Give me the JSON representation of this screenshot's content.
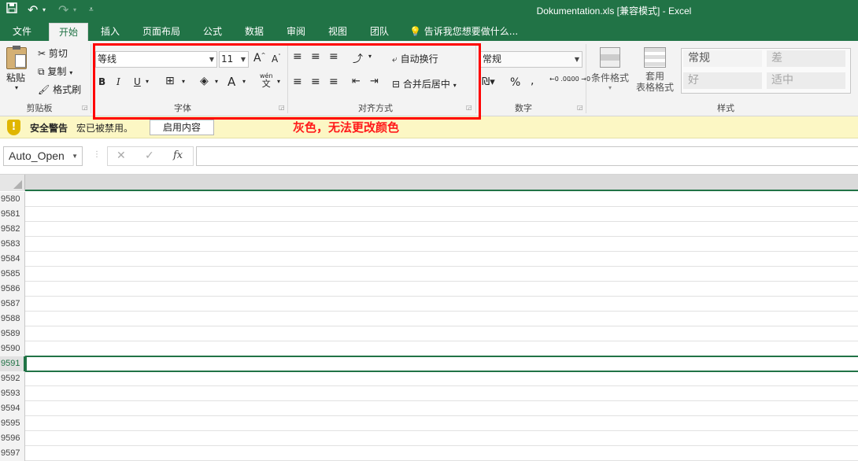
{
  "titlebar": {
    "title": "Dokumentation.xls  [兼容模式]  -  Excel",
    "save_icon": "save-icon",
    "undo_icon": "undo-icon",
    "redo_icon": "redo-icon",
    "customize_icon": "customize-qat-icon"
  },
  "tabs": [
    "文件",
    "开始",
    "插入",
    "页面布局",
    "公式",
    "数据",
    "审阅",
    "视图",
    "团队"
  ],
  "active_tab": "开始",
  "tell_me": "告诉我您想要做什么...",
  "ribbon": {
    "clipboard": {
      "paste": "粘贴",
      "cut": "剪切",
      "copy": "复制",
      "format_painter": "格式刷",
      "label": "剪贴板"
    },
    "font": {
      "font_name": "等线",
      "font_size": "11",
      "grow": "A",
      "shrink": "A",
      "bold": "B",
      "italic": "I",
      "underline": "U",
      "font_color": "A",
      "phonetic": "wén",
      "phonetic_sub": "文",
      "label": "字体"
    },
    "alignment": {
      "wrap_text": "自动换行",
      "merge_center": "合并后居中",
      "label": "对齐方式"
    },
    "number": {
      "format": "常规",
      "percent": "%",
      "comma": ",",
      "inc_decimal": "←0 .00",
      "dec_decimal": ".00 →0",
      "label": "数字"
    },
    "styles": {
      "conditional_formatting": "条件格式",
      "format_as_table_1": "套用",
      "format_as_table_2": "表格格式",
      "normal": "常规",
      "bad": "差",
      "good": "好",
      "neutral": "适中",
      "label": "样式"
    }
  },
  "security_bar": {
    "title": "安全警告",
    "message": "宏已被禁用。",
    "button": "启用内容"
  },
  "formula_bar": {
    "name_box": "Auto_Open",
    "cancel": "✕",
    "enter": "✓",
    "fx": "fx",
    "value": ""
  },
  "rows": [
    "9580",
    "9581",
    "9582",
    "9583",
    "9584",
    "9585",
    "9586",
    "9587",
    "9588",
    "9589",
    "9590",
    "9591",
    "9592",
    "9593",
    "9594",
    "9595",
    "9596",
    "9597"
  ],
  "selected_row": "9591",
  "annotation": {
    "text": "灰色，无法更改颜色",
    "color": "#ff0000"
  },
  "colors": {
    "excel_green": "#217346",
    "ribbon_bg": "#f3f3f3",
    "security_bg": "#fcf7c4"
  }
}
